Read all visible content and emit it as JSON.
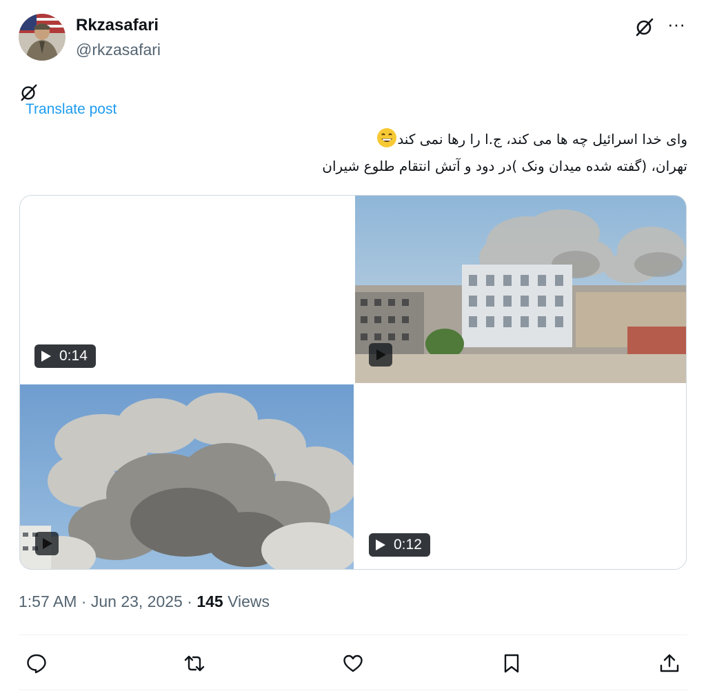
{
  "author": {
    "display_name": "Rkzasafari",
    "handle": "@rkzasafari",
    "avatar_icon": "avatar-photo"
  },
  "header_icons": [
    "grok-icon",
    "more-icon"
  ],
  "more_label": "···",
  "translate_label": "Translate post",
  "post": {
    "line1": "وای خدا اسرائیل چه ها می کند، ج.ا را رها نمی کند",
    "line2": "تهران، (گفته شده میدان ونک )در دود و آتش انتقام طلوع شیران",
    "emoji_icon": "grinning-face-emoji"
  },
  "media": [
    {
      "duration": "0:14"
    },
    {
      "duration": ""
    },
    {
      "duration": ""
    },
    {
      "duration": "0:12"
    }
  ],
  "meta": {
    "time": "1:57 AM",
    "date": "Jun 23, 2025",
    "views_count": "145",
    "views_label": "Views",
    "separator": "·"
  },
  "actions": [
    "reply-icon",
    "repost-icon",
    "like-icon",
    "bookmark-icon",
    "share-icon"
  ],
  "colors": {
    "link": "#1d9bf0",
    "text": "#0f1419",
    "secondary": "#536471",
    "border": "#cfd9de"
  }
}
